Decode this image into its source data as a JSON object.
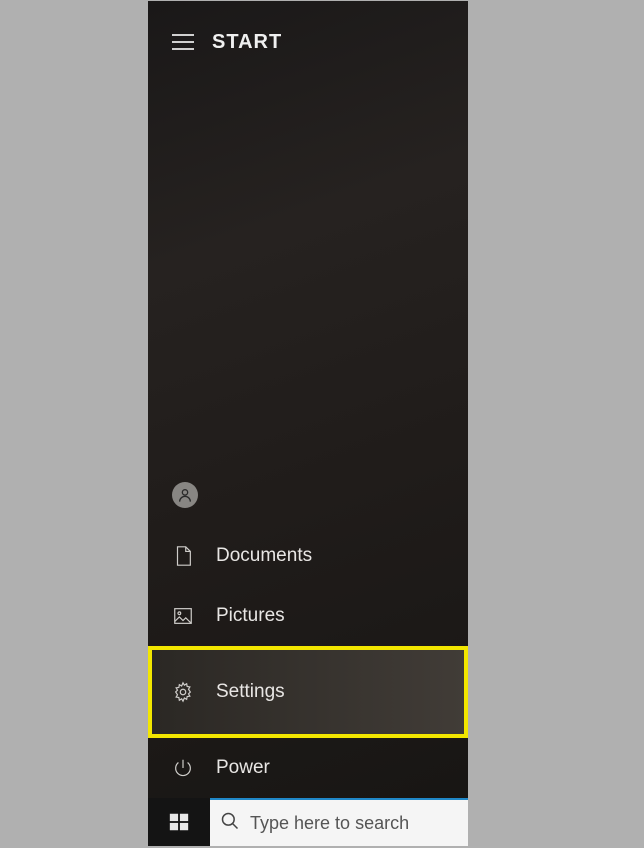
{
  "header": {
    "title": "START"
  },
  "menu": {
    "documents_label": "Documents",
    "pictures_label": "Pictures",
    "settings_label": "Settings",
    "power_label": "Power"
  },
  "taskbar": {
    "search_placeholder": "Type here to search"
  }
}
